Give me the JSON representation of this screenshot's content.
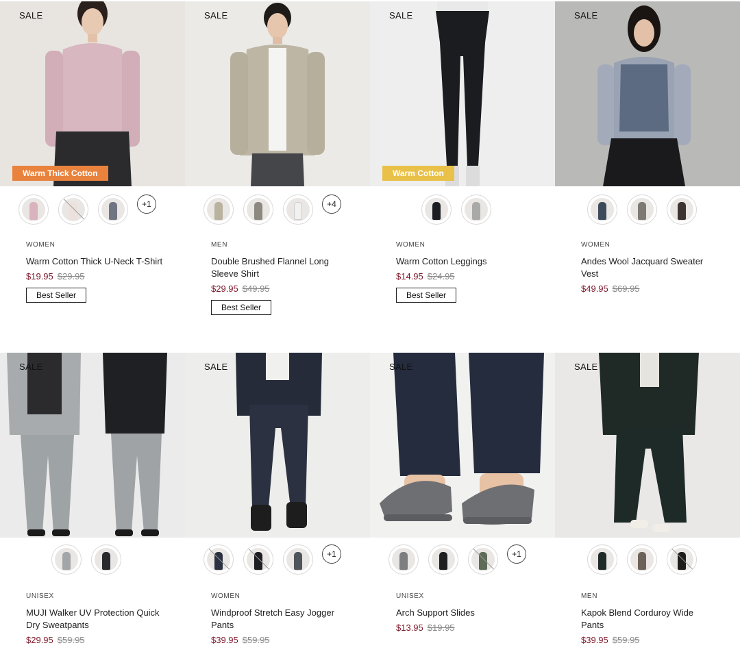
{
  "sale_label": "SALE",
  "products": [
    {
      "category": "WOMEN",
      "name": "Warm Cotton Thick U-Neck T-Shirt",
      "price": "$19.95",
      "was": "$29.95",
      "badge": "Best Seller",
      "tag": "Warm Thick Cotton",
      "tag_color": "#e9823d",
      "swatches": [
        "#d9b3bd",
        "#ece1dc",
        "#6f7583"
      ],
      "swatch_more": "+1"
    },
    {
      "category": "MEN",
      "name": "Double Brushed Flannel Long Sleeve Shirt",
      "price": "$29.95",
      "was": "$49.95",
      "badge": "Best Seller",
      "swatches": [
        "#b9b29f",
        "#8c8a80",
        "#f1f1ef"
      ],
      "swatch_more": "+4"
    },
    {
      "category": "WOMEN",
      "name": "Warm Cotton Leggings",
      "price": "$14.95",
      "was": "$24.95",
      "badge": "Best Seller",
      "tag": "Warm Cotton",
      "tag_color": "#e9c149",
      "swatches": [
        "#1c1d22",
        "#a9a9a8"
      ]
    },
    {
      "category": "WOMEN",
      "name": "Andes Wool Jacquard Sweater Vest",
      "price": "$49.95",
      "was": "$69.95",
      "swatches": [
        "#3d4a5c",
        "#7c7a72",
        "#3b3432"
      ]
    },
    {
      "category": "UNISEX",
      "name": "MUJI Walker UV Protection Quick Dry Sweatpants",
      "price": "$29.95",
      "was": "$59.95",
      "swatches": [
        "#a2a6a8",
        "#27292d"
      ]
    },
    {
      "category": "WOMEN",
      "name": "Windproof Stretch Easy Jogger Pants",
      "price": "$39.95",
      "was": "$59.95",
      "swatches": [
        "#2b3140",
        "#1d1e22",
        "#50555c"
      ],
      "swatch_more": "+1"
    },
    {
      "category": "UNISEX",
      "name": "Arch Support Slides",
      "price": "$13.95",
      "was": "$19.95",
      "swatches": [
        "#7d7e80",
        "#1f1f21",
        "#5d6b57"
      ],
      "swatch_more": "+1"
    },
    {
      "category": "MEN",
      "name": "Kapok Blend Corduroy Wide Pants",
      "price": "$39.95",
      "was": "$59.95",
      "swatches": [
        "#1e2a27",
        "#6d6258",
        "#1f1d1c"
      ]
    }
  ]
}
